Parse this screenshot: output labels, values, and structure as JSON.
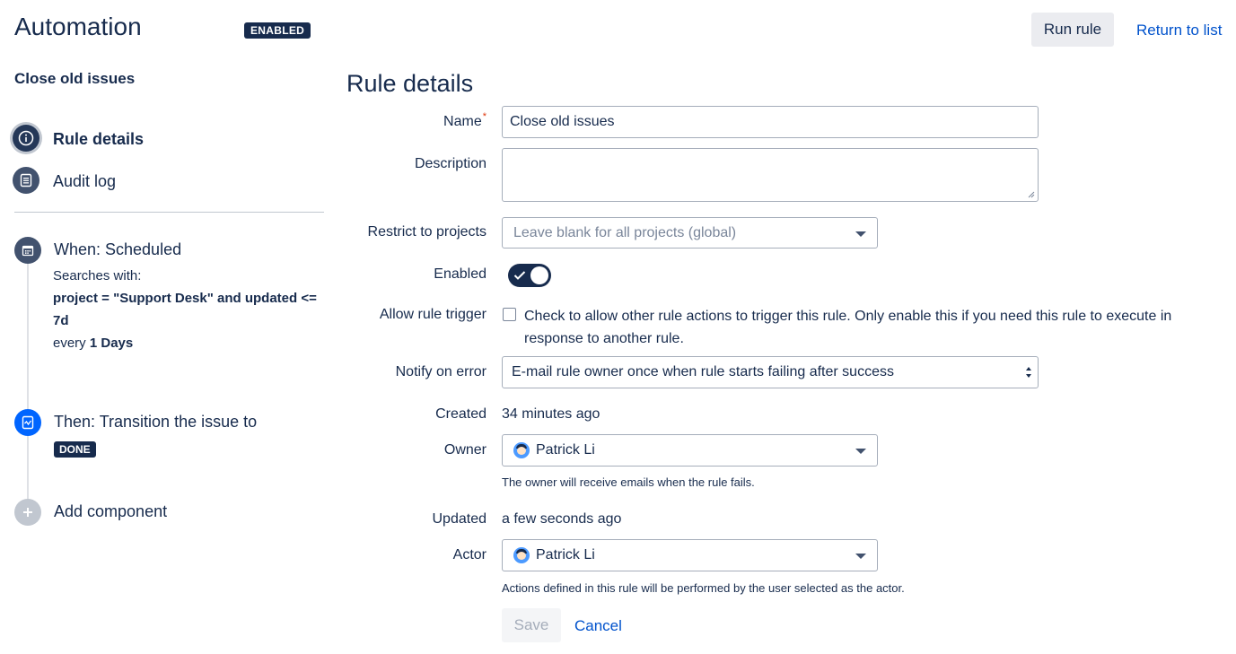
{
  "header": {
    "app_title": "Automation",
    "status_badge": "ENABLED",
    "run_rule_label": "Run rule",
    "return_link": "Return to list"
  },
  "sidebar": {
    "rule_name": "Close old issues",
    "nav": [
      {
        "label": "Rule details",
        "icon": "info-icon",
        "active": true
      },
      {
        "label": "Audit log",
        "icon": "list-icon",
        "active": false
      }
    ],
    "components": {
      "trigger": {
        "title": "When: Scheduled",
        "searches_with": "Searches with:",
        "jql": "project = \"Support Desk\" and updated <= 7d",
        "every_prefix": "every",
        "every_value": "1 Days",
        "icon": "calendar-icon"
      },
      "action": {
        "title": "Then: Transition the issue to",
        "status": "DONE",
        "icon": "transition-icon"
      },
      "add": {
        "label": "Add component",
        "icon": "plus-icon"
      }
    }
  },
  "form": {
    "title": "Rule details",
    "name": {
      "label": "Name",
      "value": "Close old issues"
    },
    "description": {
      "label": "Description",
      "value": ""
    },
    "projects": {
      "label": "Restrict to projects",
      "placeholder": "Leave blank for all projects (global)"
    },
    "enabled": {
      "label": "Enabled",
      "on": true
    },
    "allow_trigger": {
      "label": "Allow rule trigger",
      "text": "Check to allow other rule actions to trigger this rule. Only enable this if you need this rule to execute in response to another rule.",
      "checked": false
    },
    "notify": {
      "label": "Notify on error",
      "value": "E-mail rule owner once when rule starts failing after success"
    },
    "created": {
      "label": "Created",
      "value": "34 minutes ago"
    },
    "owner": {
      "label": "Owner",
      "value": "Patrick Li",
      "helper": "The owner will receive emails when the rule fails."
    },
    "updated": {
      "label": "Updated",
      "value": "a few seconds ago"
    },
    "actor": {
      "label": "Actor",
      "value": "Patrick Li",
      "helper": "Actions defined in this rule will be performed by the user selected as the actor."
    },
    "save_label": "Save",
    "cancel_label": "Cancel"
  },
  "colors": {
    "primary_text": "#172b4d",
    "link": "#0052cc",
    "action_blue": "#0065ff",
    "required": "#de350b"
  }
}
